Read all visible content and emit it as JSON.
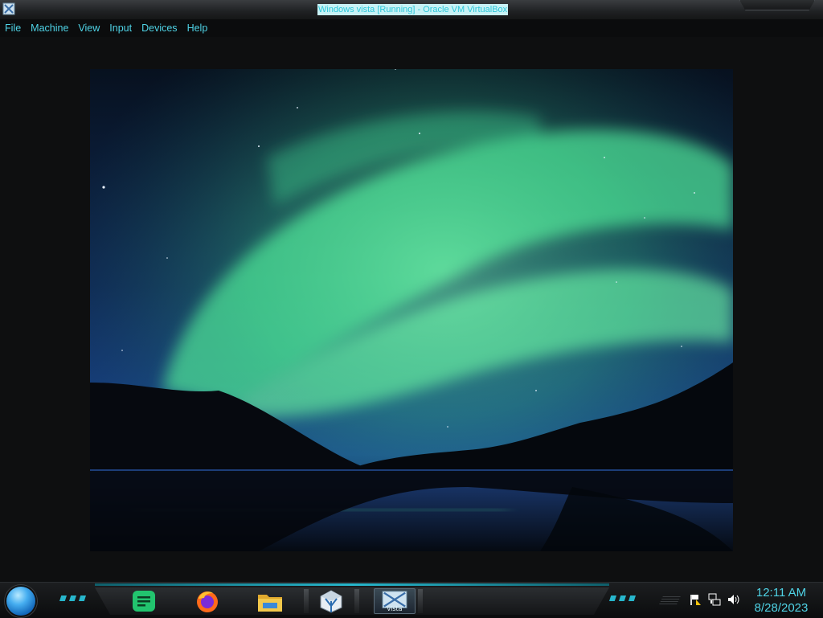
{
  "window": {
    "title": "Windows vista [Running] - Oracle VM VirtualBox"
  },
  "menu": {
    "items": [
      {
        "label": "File"
      },
      {
        "label": "Machine"
      },
      {
        "label": "View"
      },
      {
        "label": "Input"
      },
      {
        "label": "Devices"
      },
      {
        "label": "Help"
      }
    ]
  },
  "desktop": {
    "wallpaper": "aurora-over-lake"
  },
  "taskbar": {
    "start_icon": "start-orb",
    "pinned": [
      {
        "name": "notes-app",
        "icon": "notes-icon",
        "color": "#22c46e"
      },
      {
        "name": "firefox",
        "icon": "firefox-icon"
      },
      {
        "name": "file-explorer",
        "icon": "folder-icon",
        "color": "#f2c84b"
      },
      {
        "name": "virtualbox",
        "icon": "virtualbox-icon"
      },
      {
        "name": "virtualbox-vista-vm",
        "icon": "vm-icon",
        "tag": "vista",
        "active": true
      }
    ],
    "tray": {
      "icons": [
        "action-center-flag-icon",
        "network-icon",
        "volume-icon"
      ]
    },
    "clock": {
      "time": "12:11 AM",
      "date": "8/28/2023"
    }
  },
  "colors": {
    "accent": "#4fd3e6",
    "background": "#0b0c0d"
  }
}
